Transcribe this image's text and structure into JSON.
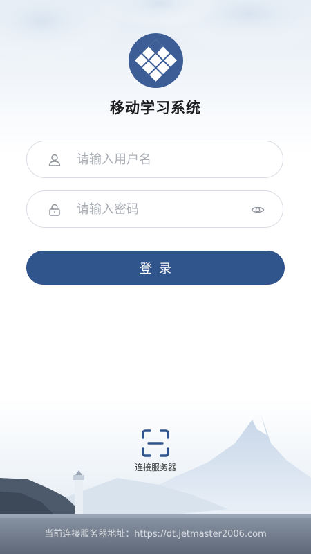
{
  "app": {
    "title": "移动学习系统",
    "logo_icon": "grid-diamond-logo-icon",
    "accent_color": "#30548c"
  },
  "form": {
    "username": {
      "icon": "user-icon",
      "placeholder": "请输入用户名",
      "value": ""
    },
    "password": {
      "icon": "lock-icon",
      "placeholder": "请输入密码",
      "value": "",
      "toggle_icon": "eye-icon"
    },
    "login_label": "登录"
  },
  "connect": {
    "icon": "scan-icon",
    "label": "连接服务器"
  },
  "footer": {
    "server_text": "当前连接服务器地址：https://dt.jetmaster2006.com"
  }
}
